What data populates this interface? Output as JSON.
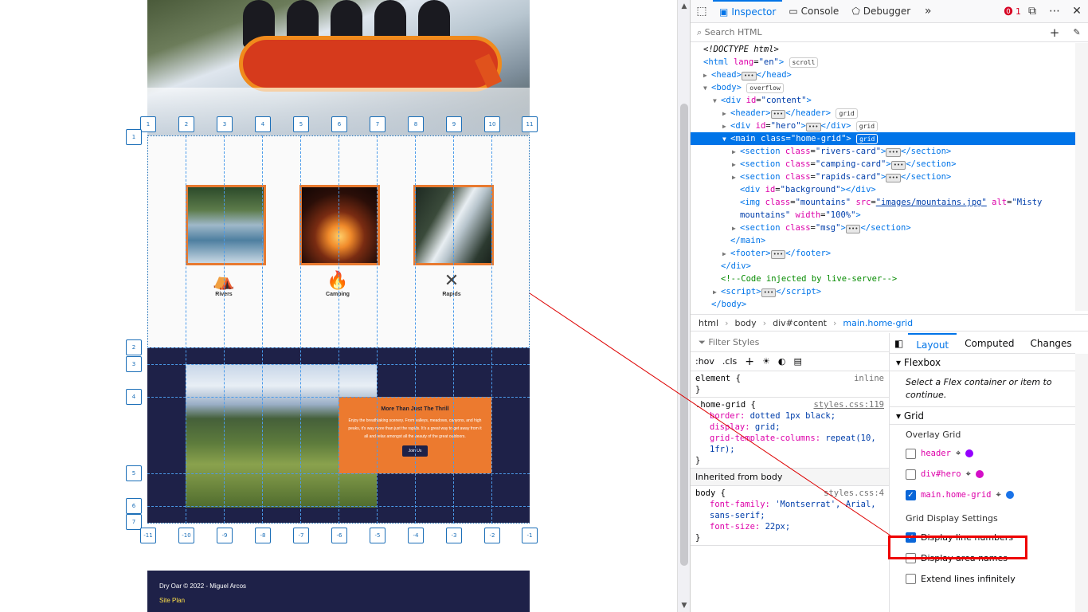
{
  "page": {
    "rivers_label": "Rivers",
    "camping_label": "Camping",
    "rapids_label": "Rapids",
    "msg_title": "More Than Just The Thrill",
    "msg_body": "Enjoy the breathtaking scenery. From valleys, meadows, canyons, and high peaks, it's way more than just the rapids. It's a great way to get away from it all and relax amongst all the beauty of the great outdoors.",
    "join_button": "Join Us",
    "footer_copy": "Dry Oar © 2022 - Miguel Arcos",
    "footer_link": "Site Plan",
    "line_numbers_top": [
      "1",
      "2",
      "3",
      "4",
      "5",
      "6",
      "7",
      "8",
      "9",
      "10",
      "11"
    ],
    "line_numbers_left": [
      "1",
      "2",
      "3",
      "4",
      "5",
      "6",
      "7"
    ],
    "line_numbers_bottom": [
      "-11",
      "-10",
      "-9",
      "-8",
      "-7",
      "-6",
      "-5",
      "-4",
      "-3",
      "-2",
      "-1"
    ]
  },
  "devtools": {
    "tabs": [
      "Inspector",
      "Console",
      "Debugger"
    ],
    "error_count": "1",
    "search_placeholder": "Search HTML",
    "breadcrumbs": [
      "html",
      "body",
      "div#content",
      "main.home-grid"
    ],
    "filter_placeholder": "Filter Styles",
    "hov": ":hov",
    "cls": ".cls",
    "layout_tabs": [
      "Layout",
      "Computed",
      "Changes"
    ],
    "flexbox_title": "Flexbox",
    "flexbox_note": "Select a Flex container or item to continue.",
    "grid_title": "Grid",
    "overlay_grid_label": "Overlay Grid",
    "overlays": [
      {
        "name": "header",
        "checked": false,
        "color": "#9400ff"
      },
      {
        "name": "div#hero",
        "checked": false,
        "color": "#d40ec7"
      },
      {
        "name": "main.home-grid",
        "checked": true,
        "color": "#1a73e8"
      }
    ],
    "display_settings_label": "Grid Display Settings",
    "settings": [
      {
        "label": "Display line numbers",
        "checked": true
      },
      {
        "label": "Display area names",
        "checked": false
      },
      {
        "label": "Extend lines infinitely",
        "checked": false
      }
    ],
    "rules": {
      "element_selector": "element {",
      "element_src": "inline",
      "home_selector": ".home-grid {",
      "home_src": "styles.css:119",
      "home_props": [
        {
          "name": "border",
          "value": "dotted 1px black;"
        },
        {
          "name": "display",
          "value": "grid;"
        },
        {
          "name": "grid-template-columns",
          "value": "repeat(10, 1fr);"
        }
      ],
      "inherited": "Inherited from body",
      "body_selector": "body {",
      "body_src": "styles.css:4",
      "body_props": [
        {
          "name": "font-family",
          "value": "'Montserrat', Arial, sans-serif;"
        },
        {
          "name": "font-size",
          "value": "22px;"
        }
      ]
    }
  },
  "colors": {
    "accent_blue": "#0074e8",
    "brand_orange": "#ec7a2f",
    "brand_navy": "#1e2148",
    "highlight_red": "#e00000"
  }
}
